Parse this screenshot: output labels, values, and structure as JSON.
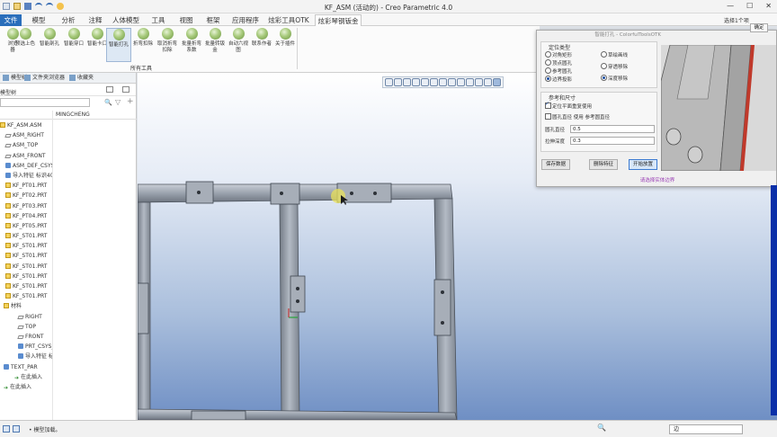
{
  "window": {
    "title": "KF_ASM (活动的) - Creo Parametric 4.0",
    "minimize": "—",
    "maximize": "☐",
    "close": "✕"
  },
  "menu": {
    "tabs": [
      "文件",
      "模型",
      "分析",
      "注释",
      "人体模型",
      "工具",
      "视图",
      "框架",
      "应用程序",
      "炫彩工具OTK",
      "炫彩琴钢钣金"
    ],
    "active_index": 10
  },
  "ribbon": {
    "buttons": [
      "浏览\n器",
      "预选上色",
      "智能剖孔",
      "智能穿口",
      "智能卡口",
      "智能打孔",
      "折弯扣除",
      "取消折弯\n扣除",
      "批量折弯\n系数",
      "批量转钣\n金",
      "自动六视\n图",
      "联系作者",
      "关于插件"
    ],
    "selected_index": 5,
    "group_label": "所有工具"
  },
  "left_panel": {
    "tabs": [
      "模型树",
      "文件夹浏览器",
      "收藏夹"
    ],
    "title": "模型树",
    "column_header": "MINGCHENG",
    "tree": [
      {
        "label": "KF_ASM.ASM",
        "icon": "assembly-icon"
      },
      {
        "label": "ASM_RIGHT",
        "icon": "plane-icon"
      },
      {
        "label": "ASM_TOP",
        "icon": "plane-icon"
      },
      {
        "label": "ASM_FRONT",
        "icon": "plane-icon"
      },
      {
        "label": "ASM_DEF_CSYS",
        "icon": "csys-icon"
      },
      {
        "label": "导入特征 标识40",
        "icon": "feature-icon"
      },
      {
        "label": "KF_PT01.PRT",
        "icon": "part-icon"
      },
      {
        "label": "KF_PT02.PRT",
        "icon": "part-icon"
      },
      {
        "label": "KF_PT03.PRT",
        "icon": "part-icon"
      },
      {
        "label": "KF_PT04.PRT",
        "icon": "part-icon"
      },
      {
        "label": "KF_PT05.PRT",
        "icon": "part-icon"
      },
      {
        "label": "KF_ST01.PRT",
        "icon": "part-icon"
      },
      {
        "label": "KF_ST01.PRT",
        "icon": "part-icon"
      },
      {
        "label": "KF_ST01.PRT",
        "icon": "part-icon"
      },
      {
        "label": "KF_ST01.PRT",
        "icon": "part-icon"
      },
      {
        "label": "KF_ST01.PRT",
        "icon": "part-icon"
      },
      {
        "label": "KF_ST01.PRT",
        "icon": "part-icon"
      },
      {
        "label": "KF_ST01.PRT",
        "icon": "part-icon"
      },
      {
        "label": "材料",
        "icon": "folder-icon"
      },
      {
        "label": "RIGHT",
        "icon": "plane-icon"
      },
      {
        "label": "TOP",
        "icon": "plane-icon"
      },
      {
        "label": "FRONT",
        "icon": "plane-icon"
      },
      {
        "label": "PRT_CSYS_DEF",
        "icon": "csys-icon"
      },
      {
        "label": "导入特征 标识1",
        "icon": "feature-icon"
      },
      {
        "label": "TEXT_PAR",
        "icon": "feature-icon"
      },
      {
        "label": "在此插入",
        "icon": "insert-arrow-icon"
      },
      {
        "label": "在此插入",
        "icon": "insert-arrow-icon"
      }
    ]
  },
  "dialog": {
    "title": "智能打孔 - ColorfulToolsOTK",
    "position_group": {
      "title": "定位类型",
      "options": [
        "对角矩形",
        "顶点圆孔",
        "参考圆孔",
        "边界投影",
        "草绘画线",
        "穿透移除",
        "深度移除"
      ],
      "selected": [
        "边界投影",
        "深度移除"
      ]
    },
    "ref_group": {
      "title": "参考和尺寸",
      "check_plane": "定位平面重复使用",
      "check_plane_on": true,
      "check_hole": "圆孔直径 使用 参考圆直径",
      "check_hole_on": false,
      "diameter_label": "圆孔直径",
      "diameter_value": "0.5",
      "depth_label": "拉伸深度",
      "depth_value": "0.3"
    },
    "buttons": {
      "save": "保存数据",
      "delete": "删除特征",
      "start": "开始放置"
    },
    "hint": "请选择实体边界"
  },
  "right_panel": {
    "select_label": "选择1个项",
    "confirm": "确定"
  },
  "statusbar": {
    "message": "• 模型加载。",
    "filter": "边"
  },
  "colors": {
    "accent": "#2a6ebb",
    "highlight_edge": "#c0392b",
    "frame_gray": "#8f97a3"
  }
}
